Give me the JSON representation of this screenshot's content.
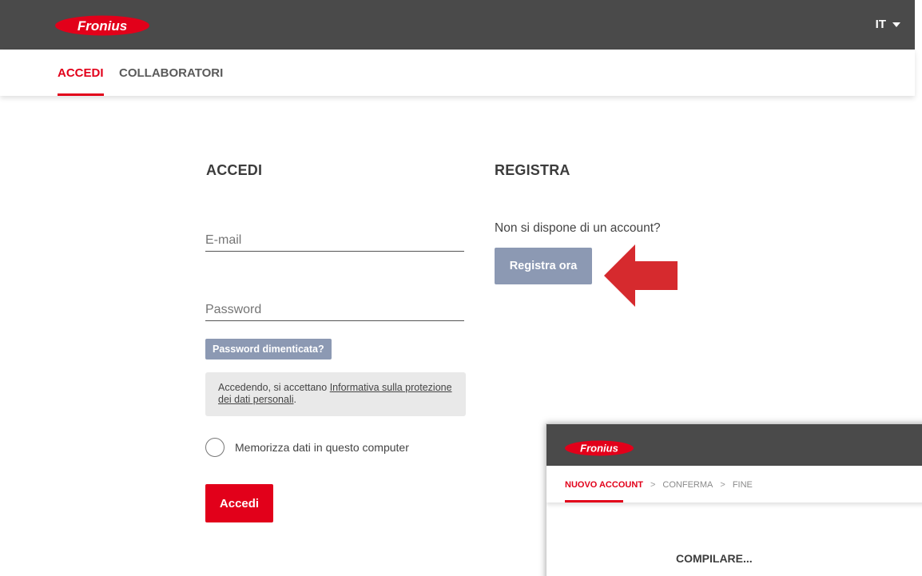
{
  "header": {
    "brand": "Fronius",
    "language": "IT"
  },
  "nav": {
    "tabs": [
      {
        "label": "ACCEDI",
        "active": true
      },
      {
        "label": "COLLABORATORI",
        "active": false
      }
    ]
  },
  "login": {
    "title": "ACCEDI",
    "email_placeholder": "E-mail",
    "password_placeholder": "Password",
    "forgot_label": "Password dimenticata?",
    "notice_prefix": "Accedendo, si accettano ",
    "notice_link": "Informativa sulla protezione dei dati personali",
    "notice_suffix": ".",
    "remember_label": "Memorizza dati in questo computer",
    "submit_label": "Accedi"
  },
  "register": {
    "title": "REGISTRA",
    "prompt": "Non si dispone di un account?",
    "button_label": "Registra ora"
  },
  "inset": {
    "brand": "Fronius",
    "steps": [
      "NUOVO ACCOUNT",
      "CONFERMA",
      "FINE"
    ],
    "separator": ">",
    "heading": "COMPILARE..."
  },
  "colors": {
    "brand_red": "#e2001a",
    "header_bg": "#4a4a4a",
    "secondary_button": "#8c99b3",
    "arrow": "#d62a2e"
  }
}
